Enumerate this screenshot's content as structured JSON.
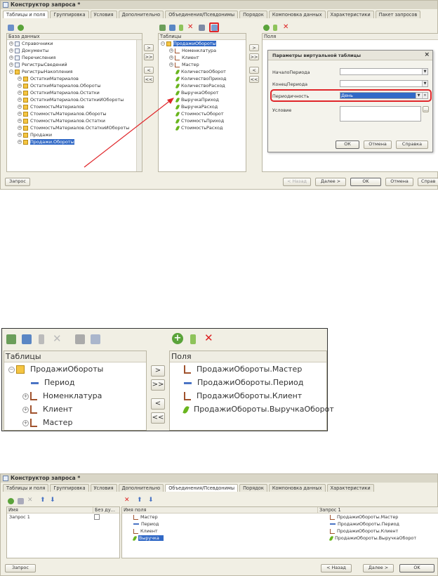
{
  "window1": {
    "title": "Конструктор запроса *",
    "tabs": [
      "Таблицы и поля",
      "Группировка",
      "Условия",
      "Дополнительно",
      "Объединения/Псевдонимы",
      "Порядок",
      "Компоновка данных",
      "Характеристики",
      "Пакет запросов"
    ],
    "db_header": "База данных",
    "db_items": [
      "Справочники",
      "Документы",
      "Перечисления",
      "РегистрыСведений",
      "РегистрыНакопления",
      "ОстаткиМатериалов",
      "ОстаткиМатериалов.Обороты",
      "ОстаткиМатериалов.Остатки",
      "ОстаткиМатериалов.ОстаткиИОбороты",
      "СтоимостьМатериалов",
      "СтоимостьМатериалов.Обороты",
      "СтоимостьМатериалов.Остатки",
      "СтоимостьМатериалов.ОстаткиИОбороты",
      "Продажи",
      "Продажи.Обороты"
    ],
    "tables_header": "Таблицы",
    "table_items": [
      "ПродажиОбороты",
      "Номенклатура",
      "Клиент",
      "Мастер",
      "КоличествоОборот",
      "КоличествоПриход",
      "КоличествоРасход",
      "ВыручкаОборот",
      "ВыручкаПриход",
      "ВыручкаРасход",
      "СтоимостьОборот",
      "СтоимостьПриход",
      "СтоимостьРасход"
    ],
    "fields_header": "Поля",
    "move_buttons": [
      ">",
      ">>",
      "<",
      "<<"
    ],
    "bottom_buttons": {
      "query": "Запрос",
      "back": "< Назад",
      "next": "Далее >",
      "ok": "OK",
      "cancel": "Отмена",
      "help": "Справ"
    },
    "dialog": {
      "title": "Параметры виртуальной таблицы",
      "close": "×",
      "start_label": "НачалоПериода",
      "end_label": "КонецПериода",
      "period_label": "Периодичность",
      "period_value": "День",
      "cond_label": "Условие",
      "ok": "ОК",
      "cancel": "Отмена",
      "help": "Справка"
    },
    "highlight_color": "#e0262a"
  },
  "window2": {
    "tables_header": "Таблицы",
    "fields_header": "Поля",
    "tables": [
      "ПродажиОбороты",
      "Период",
      "Номенклатура",
      "Клиент",
      "Мастер"
    ],
    "fields": [
      "ПродажиОбороты.Мастер",
      "ПродажиОбороты.Период",
      "ПродажиОбороты.Клиент",
      "ПродажиОбороты.ВыручкаОборот"
    ],
    "move_buttons": [
      ">",
      ">>",
      "<",
      "<<"
    ]
  },
  "window3": {
    "title": "Конструктор запроса *",
    "tabs": [
      "Таблицы и поля",
      "Группировка",
      "Условия",
      "Дополнительно",
      "Объединения/Псевдонимы",
      "Порядок",
      "Компоновка данных",
      "Характеристики"
    ],
    "col_name": "Имя",
    "col_nodup": "Без ду...",
    "query_name": "Запрос 1",
    "col_field": "Имя поля",
    "col_query": "Запрос 1",
    "aliases": [
      "Мастер",
      "Период",
      "Клиент",
      "Выручка"
    ],
    "sources": [
      "ПродажиОбороты.Мастер",
      "ПродажиОбороты.Период",
      "ПродажиОбороты.Клиент",
      "ПродажиОбороты.ВыручкаОборот"
    ],
    "bottom_buttons": {
      "query": "Запрос",
      "back": "< Назад",
      "next": "Далее >",
      "ok": "OK"
    }
  }
}
